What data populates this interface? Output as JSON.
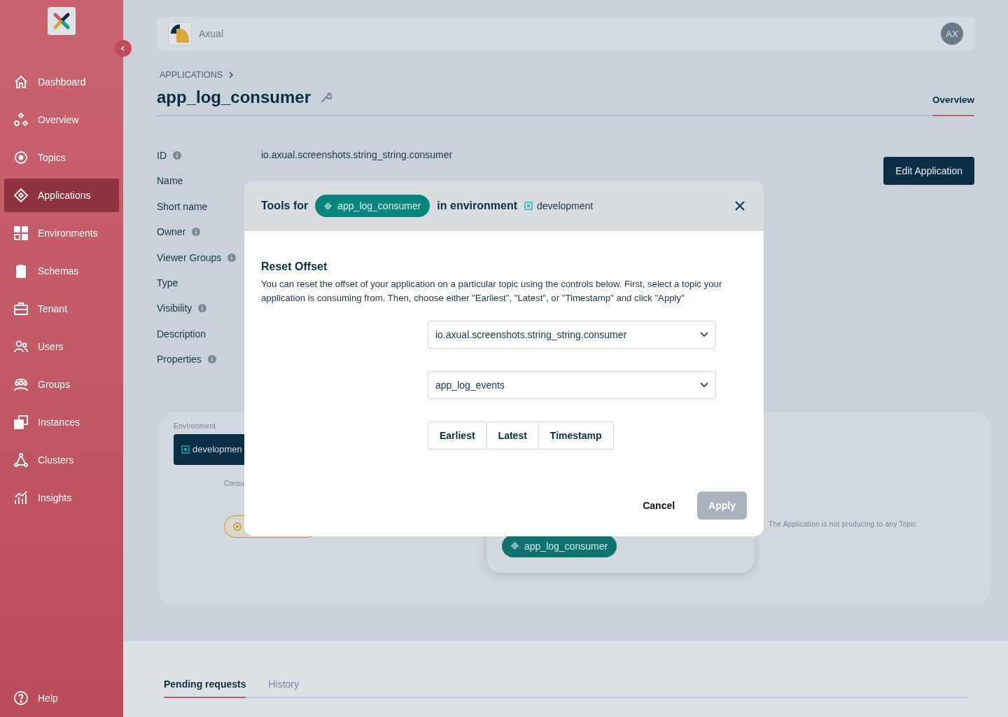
{
  "sidebar": {
    "items": [
      {
        "label": "Dashboard",
        "kind": "home",
        "selected": false
      },
      {
        "label": "Overview",
        "kind": "shapes",
        "selected": false
      },
      {
        "label": "Topics",
        "kind": "target",
        "selected": false
      },
      {
        "label": "Applications",
        "kind": "diamond",
        "selected": true
      },
      {
        "label": "Environments",
        "kind": "grid",
        "selected": false
      },
      {
        "label": "Schemas",
        "kind": "clipboard",
        "selected": false
      },
      {
        "label": "Tenant",
        "kind": "briefcase",
        "selected": false
      },
      {
        "label": "Users",
        "kind": "users",
        "selected": false
      },
      {
        "label": "Groups",
        "kind": "group",
        "selected": false
      },
      {
        "label": "Instances",
        "kind": "stack",
        "selected": false
      },
      {
        "label": "Clusters",
        "kind": "cluster",
        "selected": false
      },
      {
        "label": "Insights",
        "kind": "chart",
        "selected": false
      }
    ],
    "help": "Help"
  },
  "header": {
    "org": "Axual",
    "avatar": "AX"
  },
  "breadcrumb": "APPLICATIONS",
  "title": "app_log_consumer",
  "tabs": [
    {
      "label": "Overview",
      "selected": true
    }
  ],
  "edit_button": "Edit Application",
  "fields": [
    {
      "label": "ID",
      "info": true,
      "value": "io.axual.screenshots.string_string.consumer"
    },
    {
      "label": "Name",
      "info": false
    },
    {
      "label": "Short name",
      "info": false
    },
    {
      "label": "Owner",
      "info": true
    },
    {
      "label": "Viewer Groups",
      "info": true
    },
    {
      "label": "Type",
      "info": false
    },
    {
      "label": "Visibility",
      "info": true
    },
    {
      "label": "Description",
      "info": false
    },
    {
      "label": "Properties",
      "info": true
    }
  ],
  "environment_panel": {
    "label": "Environment",
    "environment": "developmen",
    "consumes_label": "Consu",
    "app_chip": "app_log_consumer",
    "producing_note": "The Application is not producing to any Topic"
  },
  "modal": {
    "title_prefix": "Tools for",
    "app_chip": "app_log_consumer",
    "title_middle": "in environment",
    "environment": "development",
    "section_title": "Reset Offset",
    "description": "You can reset the offset of your application on a particular topic using the controls below. First, select a topic your application is consuming from. Then, choose either \"Earliest\", \"Latest\", or \"Timestamp\" and click \"Apply\"",
    "selects": [
      "io.axual.screenshots.string_string.consumer",
      "app_log_events"
    ],
    "options": [
      "Earliest",
      "Latest",
      "Timestamp"
    ],
    "cancel": "Cancel",
    "apply": {
      "label": "Apply",
      "disabled": true
    }
  },
  "bottom_tabs": [
    {
      "label": "Pending requests",
      "selected": true
    },
    {
      "label": "History",
      "selected": false
    }
  ]
}
